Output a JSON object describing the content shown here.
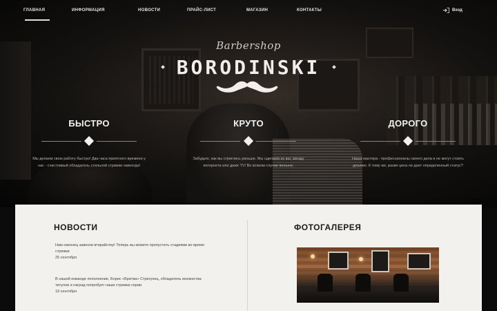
{
  "nav": {
    "items": [
      {
        "label": "Главная",
        "active": true
      },
      {
        "label": "Информация"
      },
      {
        "label": "Новости"
      },
      {
        "label": "Прайс-лист"
      },
      {
        "label": "Магазин"
      },
      {
        "label": "Контакты"
      }
    ],
    "login_label": "Вход",
    "login_icon": "login-arrow-icon"
  },
  "brand": {
    "script": "Barbershop",
    "name": "BORODINSKI",
    "logo_icon": "mustache-icon"
  },
  "features": [
    {
      "title": "БЫСТРО",
      "text": "Мы делаем свою работу быстро! Два часа приятного времени у нас - счастливый обладатель стильной стрижки навсегда!"
    },
    {
      "title": "КРУТО",
      "text": "Забудьте, как вы стриглись раньше. Мы сделаем из вас звезду интернета или даже TV! Во всяком случае внешне."
    },
    {
      "title": "ДОРОГО",
      "text": "Наши мастера - профессионалы своего дела и не могут стоить дешево. К тому же, разве цена не дает определенный статус?"
    }
  ],
  "news": {
    "title": "НОВОСТИ",
    "items": [
      {
        "text": "Нам наконец завезли втирайстер! Теперь вы можете пропустить стадиями во время стрижки",
        "date": "25 сентября"
      },
      {
        "text": "В нашей команде пополнение, Борис «Бритва» Стригунец, обладатель множества титулов и наград попробует наши стрижки серии",
        "date": "19 сентября"
      }
    ]
  },
  "gallery": {
    "title": "ФОТОГАЛЕРЕЯ"
  },
  "colors": {
    "background": "#0b0b0b",
    "card": "#f3f1ee",
    "nav_text": "#e6e6e6"
  }
}
